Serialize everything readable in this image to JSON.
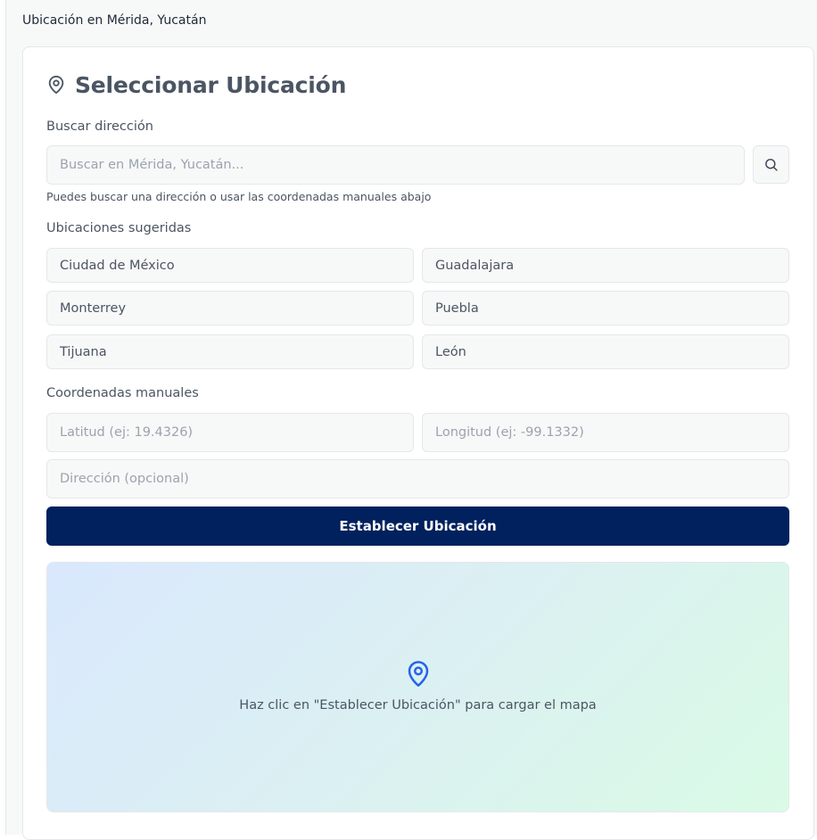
{
  "header": {
    "location_text": "Ubicación en Mérida, Yucatán"
  },
  "card": {
    "title": "Seleccionar Ubicación",
    "title_icon": "map-pin-icon",
    "search": {
      "label": "Buscar dirección",
      "placeholder": "Buscar en Mérida, Yucatán...",
      "value": "",
      "button_icon": "search-icon",
      "hint": "Puedes buscar una dirección o usar las coordenadas manuales abajo"
    },
    "suggested": {
      "label": "Ubicaciones sugeridas",
      "items": [
        "Ciudad de México",
        "Guadalajara",
        "Monterrey",
        "Puebla",
        "Tijuana",
        "León"
      ]
    },
    "manual": {
      "label": "Coordenadas manuales",
      "lat_placeholder": "Latitud (ej: 19.4326)",
      "lng_placeholder": "Longitud (ej: -99.1332)",
      "address_placeholder": "Dirección (opcional)"
    },
    "submit_label": "Establecer Ubicación",
    "map": {
      "icon": "map-pin-icon",
      "message": "Haz clic en \"Establecer Ubicación\" para cargar el mapa"
    }
  },
  "colors": {
    "primary": "#00215e",
    "map_pin": "#2563eb",
    "field_bg": "#f7f8f8",
    "border": "#e5e7eb"
  }
}
